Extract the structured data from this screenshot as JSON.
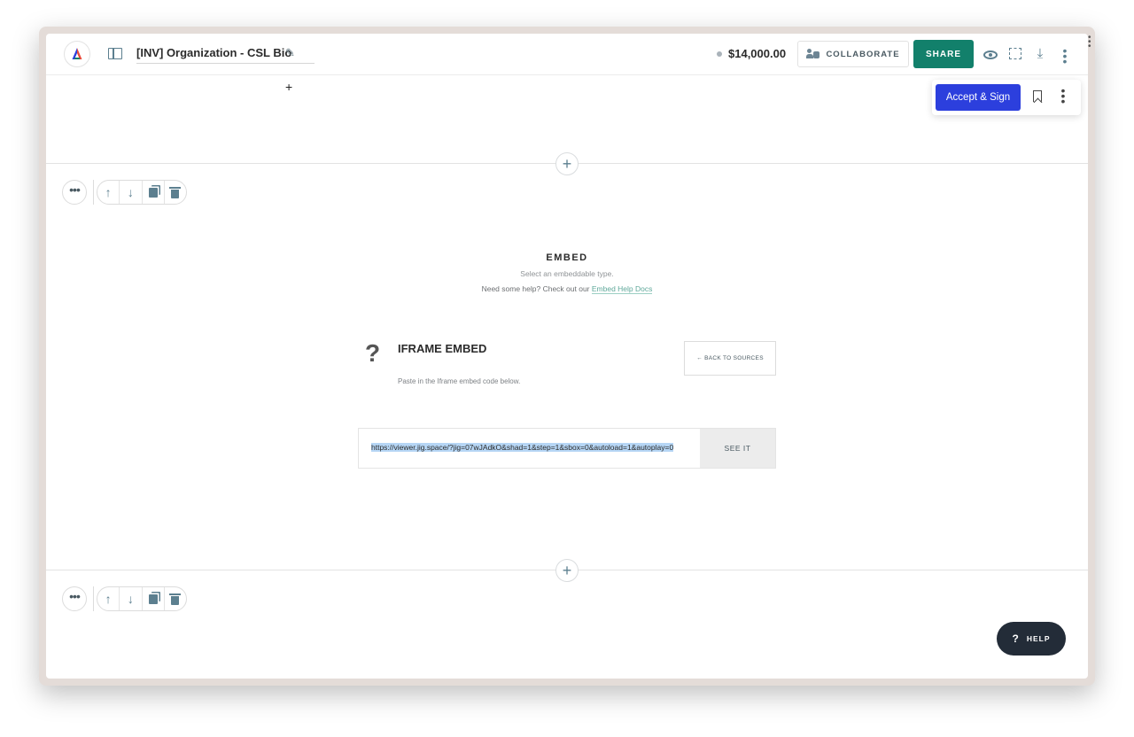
{
  "header": {
    "doc_title": "[INV] Organization - CSL Bio",
    "price": "$14,000.00",
    "collaborate_label": "COLLABORATE",
    "share_label": "SHARE"
  },
  "action_panel": {
    "accept_label": "Accept & Sign"
  },
  "embed": {
    "title": "EMBED",
    "subtitle": "Select an embeddable type.",
    "help_prefix": "Need some help? Check out our",
    "help_link": "Embed Help Docs",
    "iframe_title": "IFRAME EMBED",
    "iframe_subtitle": "Paste in the Iframe embed code below.",
    "back_label": "← BACK TO SOURCES",
    "input_value": "https://viewer.jig.space/?jig=07wJAdkO&shad=1&step=1&sbox=0&autoload=1&autoplay=0",
    "see_label": "SEE IT"
  },
  "help": {
    "label": "HELP"
  },
  "colors": {
    "share": "#12806b",
    "accept": "#2c3fdd",
    "help_bg": "#232c38",
    "icon": "#5c7f8f"
  }
}
